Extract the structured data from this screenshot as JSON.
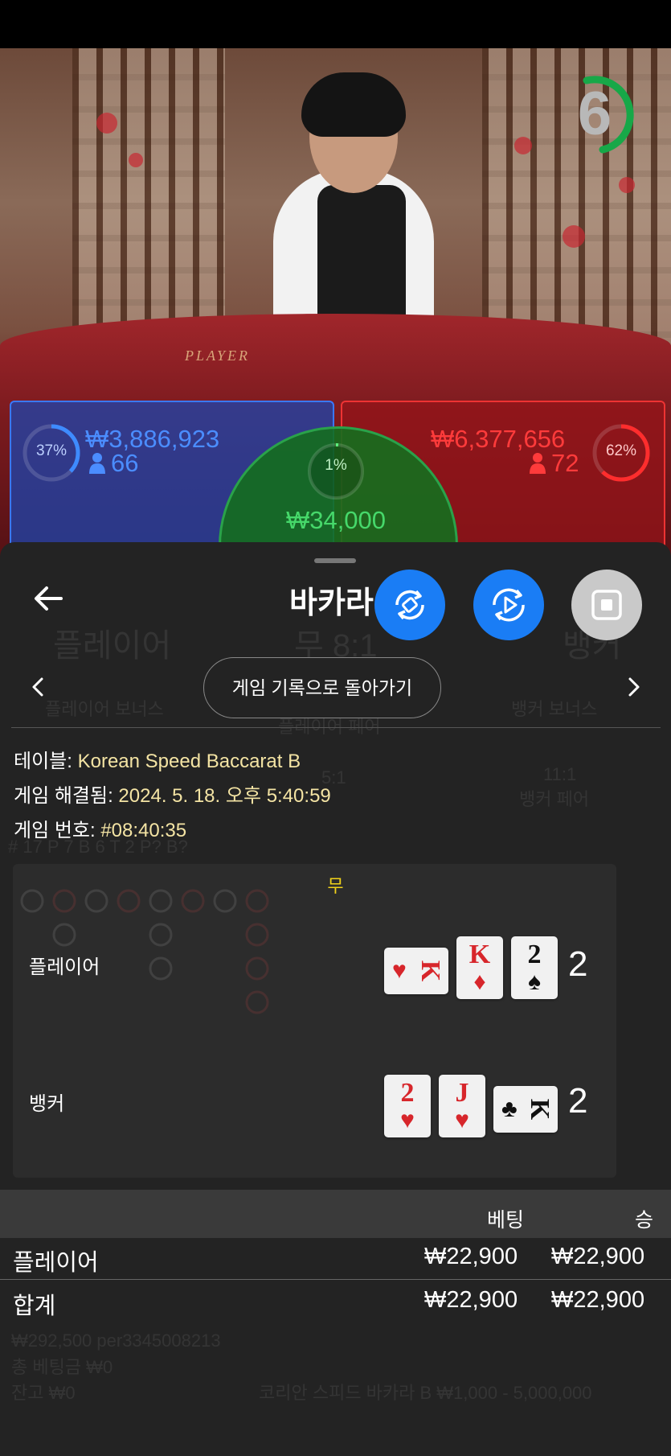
{
  "game": {
    "timer": "6",
    "table_word": "PLAYER",
    "player_bet": {
      "pct": "37%",
      "amount": "₩3,886,923",
      "count": "66"
    },
    "banker_bet": {
      "pct": "62%",
      "amount": "₩6,377,656",
      "count": "72"
    },
    "tie_bet": {
      "pct": "1%",
      "amount": "₩34,000"
    }
  },
  "sheet": {
    "title": "바카라",
    "back_to_history": "게임 기록으로 돌아가기",
    "info": {
      "table_label": "테이블:",
      "table_value": "Korean Speed Baccarat B",
      "resolved_label": "게임 해결됨:",
      "resolved_value": "2024. 5. 18. 오후 5:40:59",
      "number_label": "게임 번호:",
      "number_value": "#08:40:35"
    },
    "result": {
      "outcome": "무",
      "player_label": "플레이어",
      "player_total": "2",
      "player_cards": [
        {
          "rank": "K",
          "suit": "♥",
          "color": "#d7262b",
          "rotated": true
        },
        {
          "rank": "K",
          "suit": "♦",
          "color": "#d7262b",
          "rotated": false
        },
        {
          "rank": "2",
          "suit": "♠",
          "color": "#111111",
          "rotated": false
        }
      ],
      "banker_label": "뱅커",
      "banker_total": "2",
      "banker_cards": [
        {
          "rank": "2",
          "suit": "♥",
          "color": "#d7262b",
          "rotated": false
        },
        {
          "rank": "J",
          "suit": "♥",
          "color": "#d7262b",
          "rotated": false
        },
        {
          "rank": "K",
          "suit": "♣",
          "color": "#111111",
          "rotated": true
        }
      ]
    },
    "bets_table": {
      "headers": {
        "bet": "베팅",
        "win": "승"
      },
      "rows": [
        {
          "name": "플레이어",
          "bet": "₩22,900",
          "win": "₩22,900"
        }
      ],
      "total": {
        "name": "합계",
        "bet": "₩22,900",
        "win": "₩22,900"
      }
    }
  },
  "background_ghost": {
    "player": "플레이어",
    "tie": "무 8:1",
    "banker": "뱅커",
    "player_bonus": "플레이어 보너스",
    "player_pair": "플레이어 페어",
    "banker_bonus": "뱅커 보너스",
    "pair_5": "5:1",
    "pair_11": "11:1",
    "banker_pair": "뱅커 페어",
    "stats": "# 17   P 7   B 6   T 2        P?           B?",
    "balance_line1": "₩292,500 per3345008213",
    "balance_line2": "총 베팅금 ₩0",
    "balance_line3": "잔고 ₩0",
    "table_limits": "코리안 스피드 바카라 B ₩1,000 - 5,000,000"
  },
  "colors": {
    "accent_blue": "#1a7df5",
    "tie_yellow": "#f1d21a",
    "info_value": "#f4e4a4"
  }
}
